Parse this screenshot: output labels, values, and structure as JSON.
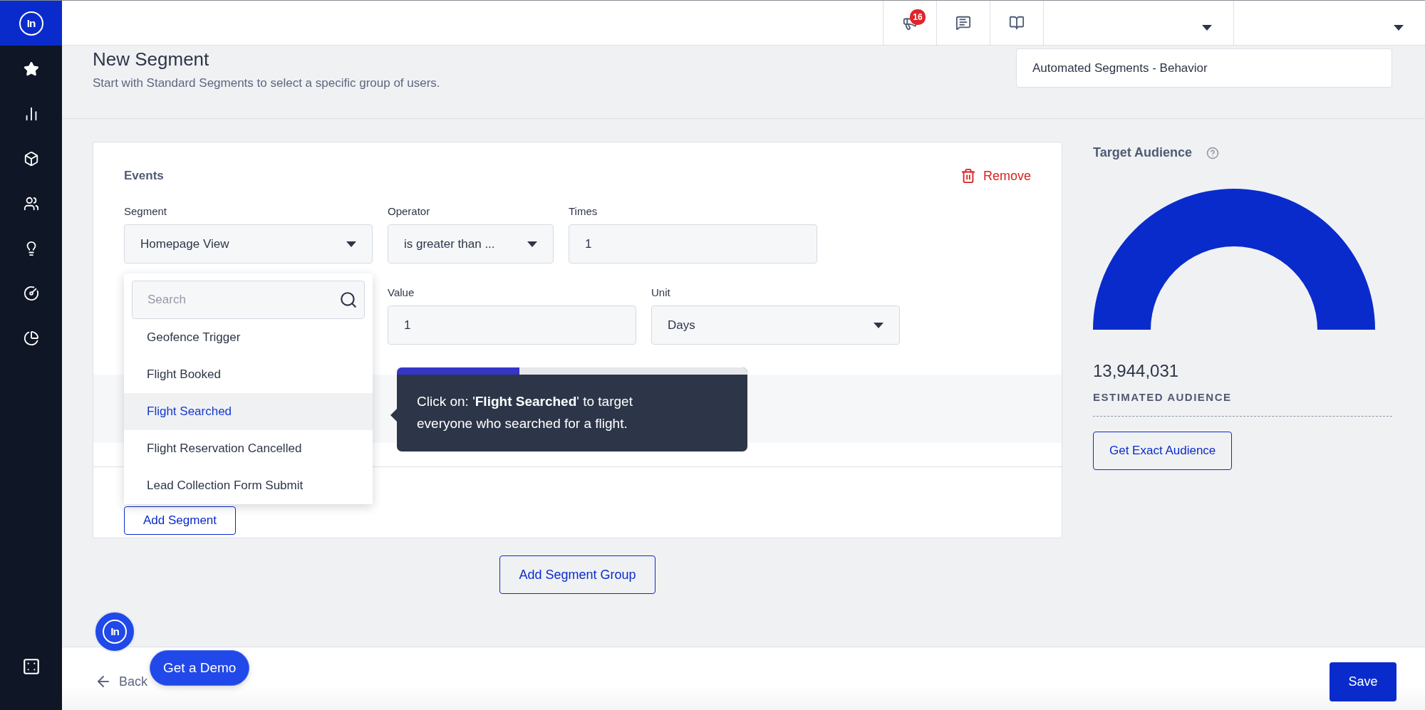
{
  "sidebar": {
    "logo": "In"
  },
  "topbar": {
    "notification_count": "16"
  },
  "header": {
    "title": "New Segment",
    "subtitle": "Start with Standard Segments to select a specific group of users.",
    "segment_type": "Automated Segments - Behavior"
  },
  "events_card": {
    "title": "Events",
    "remove": "Remove",
    "rows": [
      [
        {
          "label": "Segment",
          "kind": "select",
          "value": "Homepage View"
        },
        {
          "label": "Operator",
          "kind": "select",
          "value": "is greater than ..."
        },
        {
          "label": "Times",
          "kind": "input",
          "value": "1"
        }
      ],
      [
        "",
        {
          "label": "Value",
          "kind": "input",
          "value": "1"
        },
        {
          "label": "Unit",
          "kind": "select",
          "value": "Days"
        }
      ]
    ],
    "add_segment": "Add Segment"
  },
  "segment_dropdown": {
    "search_placeholder": "Search",
    "items": [
      {
        "label": "Geofence Trigger",
        "selected": false
      },
      {
        "label": "Flight Booked",
        "selected": false
      },
      {
        "label": "Flight Searched",
        "selected": true
      },
      {
        "label": "Flight Reservation Cancelled",
        "selected": false
      },
      {
        "label": "Lead Collection Form Submit",
        "selected": false
      }
    ]
  },
  "tooltip": {
    "text": "Click on: '**Flight Searched**' to target everyone who searched for a flight.",
    "level": 0.35
  },
  "add_segment_group": "Add Segment Group",
  "audience": {
    "title": "Target Audience",
    "level": 1,
    "count": "13,944,031",
    "caption": "ESTIMATED AUDIENCE",
    "button": "Get Exact Audience"
  },
  "chat_launcher": {
    "logo": "In"
  },
  "footer": {
    "back": "Back",
    "demo": "Get a Demo",
    "save": "Save"
  }
}
